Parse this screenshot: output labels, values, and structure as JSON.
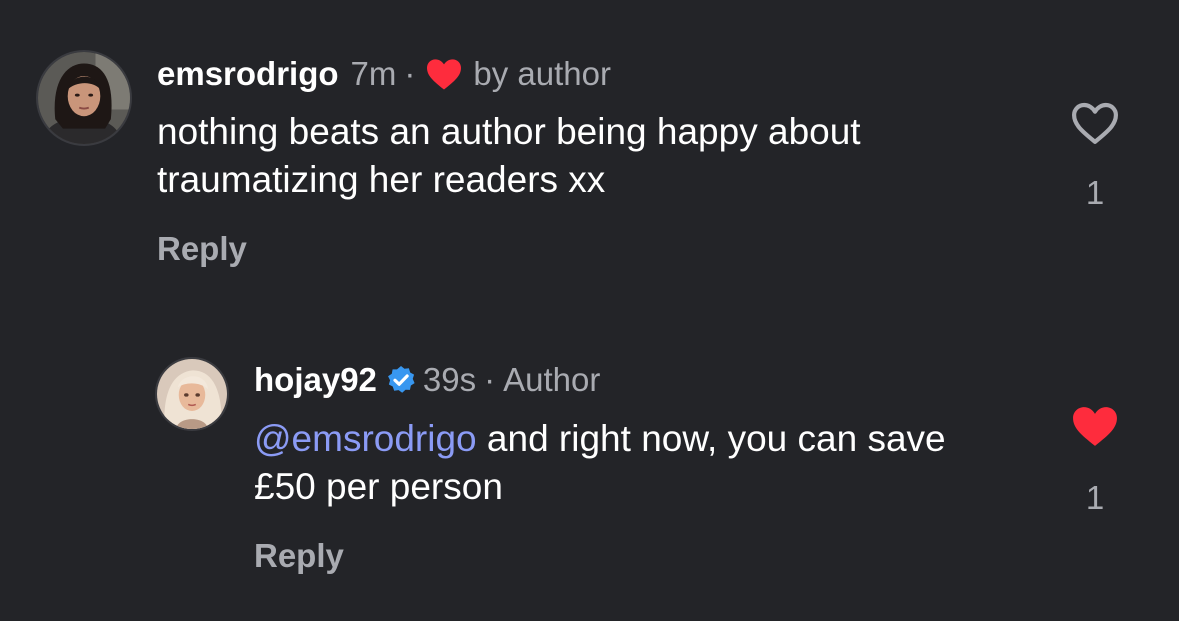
{
  "comments": [
    {
      "username": "emsrodrigo",
      "time": "7m",
      "separator": "·",
      "liked_by_author_label": "by author",
      "text": "nothing beats an author being happy about traumatizing her readers xx",
      "reply_label": "Reply",
      "like_count": "1",
      "liked": false
    },
    {
      "username": "hojay92",
      "verified": true,
      "time": "39s",
      "separator": "·",
      "author_badge": "Author",
      "mention": "@emsrodrigo",
      "text": " and right now, you can save £50 per person",
      "reply_label": "Reply",
      "like_count": "1",
      "liked": true
    }
  ],
  "colors": {
    "background": "#232428",
    "heart_red": "#fe2c3d",
    "verified_blue": "#3897f0",
    "mention": "#8b9bf5",
    "muted": "#a9abb1"
  },
  "icons": {
    "like_outline": "heart-outline-icon",
    "like_filled": "heart-filled-icon",
    "verified": "verified-badge-icon"
  }
}
